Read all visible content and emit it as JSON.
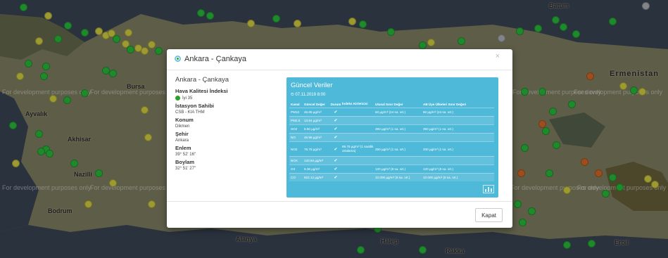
{
  "map": {
    "dev_watermark": "For development purposes only",
    "labels": {
      "batum": "Batum",
      "ermenistan": "Ermenistan",
      "bursa": "Bursa",
      "ayvalik": "Ayvalık",
      "akhisar": "Akhisar",
      "nazilli": "Nazilli",
      "bodrum": "Bodrum",
      "alanya": "Alanya",
      "halep": "Halep",
      "erbil": "Erbil",
      "rakka": "Rakka"
    },
    "marker_colors": {
      "good": "#2ecc40",
      "moderate": "#e8e34a",
      "unhealthy": "#e8742a",
      "nodata": "#bfc2c7"
    }
  },
  "modal": {
    "title": "Ankara - Çankaya",
    "close_symbol": "×",
    "info": {
      "place": "Ankara - Çankaya",
      "aqi_heading": "Hava Kalitesi İndeksi",
      "aqi_value": "İyi 35",
      "owner_heading": "İstasyon Sahibi",
      "owner_value": "CSB - KIA THM",
      "location_heading": "Konum",
      "location_value": "Dikmen",
      "city_heading": "Şehir",
      "city_value": "Ankara",
      "lat_heading": "Enlem",
      "lat_value": "39° 52' 16\"",
      "lon_heading": "Boylam",
      "lon_value": "32° 51' 27\""
    },
    "panel": {
      "title": "Güncel Veriler",
      "date": "⏲ 07.11.2019 8:00",
      "headers": [
        "Kanal",
        "Güncel Değer",
        "Durum",
        "İndeks Kirleticisi",
        "Ulusal Sınır Değer",
        "AB Üye Ülkeleri Sınır Değeri"
      ],
      "rows": [
        {
          "kanal": "PM10",
          "value": "46.85 µg/m³",
          "status": "✔",
          "index": "",
          "national": "50 µg/m³ (24 sa. ort.)",
          "eu": "50 µg/m³ (24 sa. ort.)"
        },
        {
          "kanal": "PM2.5",
          "value": "13.94 µg/m³",
          "status": "✔",
          "index": "",
          "national": "",
          "eu": ""
        },
        {
          "kanal": "SO2",
          "value": "5.50 µg/m³",
          "status": "✔",
          "index": "",
          "national": "350 µg/m³ (1 sa. ort.)",
          "eu": "350 µg/m³ (1 sa. ort.)"
        },
        {
          "kanal": "NO",
          "value": "45.96 µg/m³",
          "status": "✔",
          "index": "",
          "national": "",
          "eu": ""
        },
        {
          "kanal": "NO2",
          "value": "76.78 µg/m³",
          "status": "✔",
          "index": "69.78 µg/m³ (1 saatlik ortalama)",
          "national": "250 µg/m³ (1 sa. ort.)",
          "eu": "200 µg/m³ (1 sa. ort.)"
        },
        {
          "kanal": "NOX",
          "value": "120.84 µg/m³",
          "status": "✔",
          "index": "",
          "national": "",
          "eu": ""
        },
        {
          "kanal": "O3",
          "value": "9.36 µg/m³",
          "status": "✔",
          "index": "",
          "national": "120 µg/m³ (8 sa. ort.)",
          "eu": "120 µg/m³ (8 sa. ort.)"
        },
        {
          "kanal": "CO",
          "value": "622.12 µg/m³",
          "status": "✔",
          "index": "",
          "national": "10.000 µg/m³ (8 sa. ort.)",
          "eu": "10.000 µg/m³ (8 sa. ort.)"
        }
      ]
    },
    "footer": {
      "close_label": "Kapat"
    }
  }
}
